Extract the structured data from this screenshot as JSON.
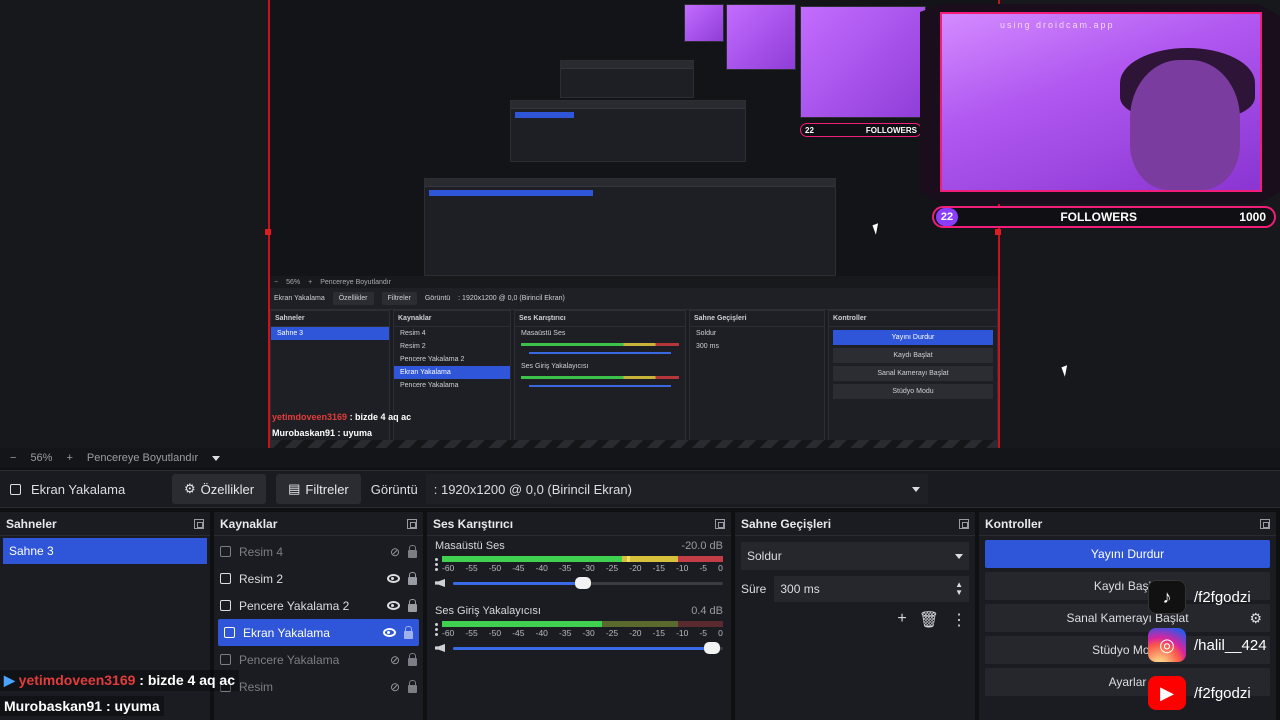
{
  "zoom": {
    "value": "56%",
    "fit_label": "Pencereye Boyutlandır",
    "minus": "−",
    "plus": "+"
  },
  "source_toolbar": {
    "selected_source": "Ekran Yakalama",
    "properties_label": "Özellikler",
    "filters_label": "Filtreler",
    "display_label": "Görüntü",
    "display_value": ": 1920x1200 @ 0,0 (Birincil Ekran)"
  },
  "scenes": {
    "title": "Sahneler",
    "items": [
      {
        "label": "Sahne 3",
        "active": true
      }
    ]
  },
  "sources": {
    "title": "Kaynaklar",
    "items": [
      {
        "label": "Resim 4",
        "icon": "image-icon",
        "visible": false
      },
      {
        "label": "Resim 2",
        "icon": "image-icon",
        "visible": true
      },
      {
        "label": "Pencere Yakalama 2",
        "icon": "window-icon",
        "visible": true
      },
      {
        "label": "Ekran Yakalama",
        "icon": "monitor-icon",
        "visible": true,
        "active": true
      },
      {
        "label": "Pencere Yakalama",
        "icon": "window-icon",
        "visible": false
      },
      {
        "label": "Resim",
        "icon": "image-icon",
        "visible": false
      }
    ]
  },
  "mixer": {
    "title": "Ses Karıştırıcı",
    "channels": [
      {
        "name": "Masaüstü Ses",
        "db": "-20.0 dB",
        "volume": 0.6,
        "level": 0.62
      },
      {
        "name": "Ses Giriş Yakalayıcısı",
        "db": "0.4 dB",
        "volume": 0.98,
        "level": 0.57
      }
    ],
    "scale": [
      "-60",
      "-55",
      "-50",
      "-45",
      "-40",
      "-35",
      "-30",
      "-25",
      "-20",
      "-15",
      "-10",
      "-5",
      "0"
    ]
  },
  "transitions": {
    "title": "Sahne Geçişleri",
    "selected": "Soldur",
    "duration_label": "Süre",
    "duration_value": "300 ms"
  },
  "controls": {
    "title": "Kontroller",
    "buttons": [
      "Yayını Durdur",
      "Kaydı Başlat",
      "Sanal Kamerayı Başlat",
      "Stüdyo Modu",
      "Ayarlar"
    ]
  },
  "socials": {
    "tiktok": "/f2fgodzi",
    "instagram": "/halil__424",
    "youtube": "/f2fgodzi"
  },
  "chat": [
    {
      "user": "yetimdoveen3169",
      "message": ": bizde 4 aq ac"
    },
    {
      "user": "Murobaskan91",
      "message": ": uyuma"
    }
  ],
  "stream_overlay": {
    "followers_label": "FOLLOWERS",
    "followers_count": "22",
    "followers_goal": "1000",
    "cam_caption": "using droidcam.app"
  },
  "colors": {
    "accent": "#2f56d8",
    "canvas_border": "#c8121e",
    "overlay_pink": "#f21d7a"
  }
}
